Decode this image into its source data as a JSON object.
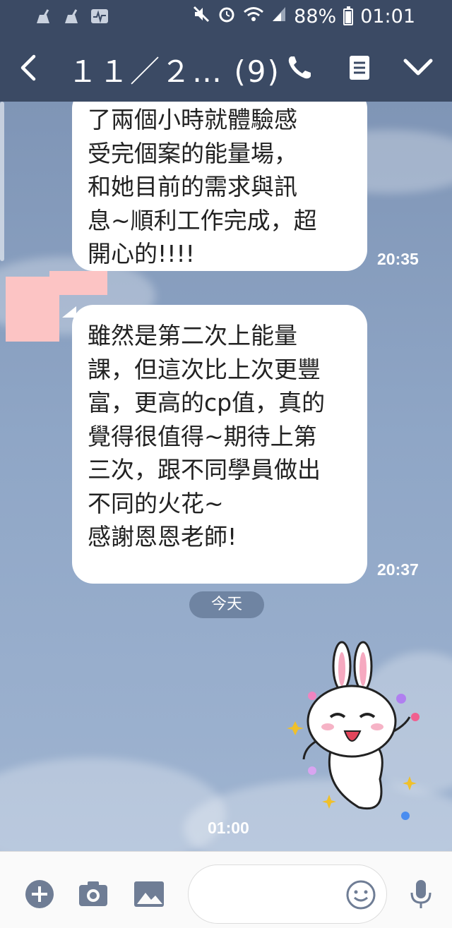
{
  "status_bar": {
    "battery_percent": "88%",
    "time": "01:01",
    "icons": [
      "clean-icon",
      "clean-icon",
      "activity-icon",
      "mute-icon",
      "alarm-icon",
      "wifi-icon",
      "signal-icon",
      "battery-icon"
    ]
  },
  "header": {
    "title": "１１／２…",
    "member_count": "(9)",
    "icons": [
      "back-icon",
      "phone-icon",
      "notes-icon",
      "chevron-down-icon"
    ]
  },
  "messages": [
    {
      "lines": [
        "了兩個小時就體驗感",
        "受完個案的能量場，",
        "和她目前的需求與訊",
        "息~順利工作完成，超",
        "開心的!!!!"
      ],
      "time": "20:35"
    },
    {
      "lines": [
        "雖然是第二次上能量",
        "課，但這次比上次更豐",
        "富，更高的cp值，真的",
        "覺得很值得~期待上第",
        "三次，跟不同學員做出",
        "不同的火花~",
        "感謝恩恩老師!"
      ],
      "time": "20:37"
    }
  ],
  "date_separator": "今天",
  "sticker": {
    "description_icon": "bunny-sticker",
    "time": "01:00"
  },
  "input_bar": {
    "placeholder": "",
    "icons": [
      "plus-icon",
      "camera-icon",
      "image-icon",
      "emoji-icon",
      "microphone-icon"
    ]
  },
  "colors": {
    "header_bg": "#3b4a64",
    "chat_bg": "#8fa6c6",
    "bubble_bg": "#ffffff",
    "input_bar_bg": "#fafafa"
  }
}
